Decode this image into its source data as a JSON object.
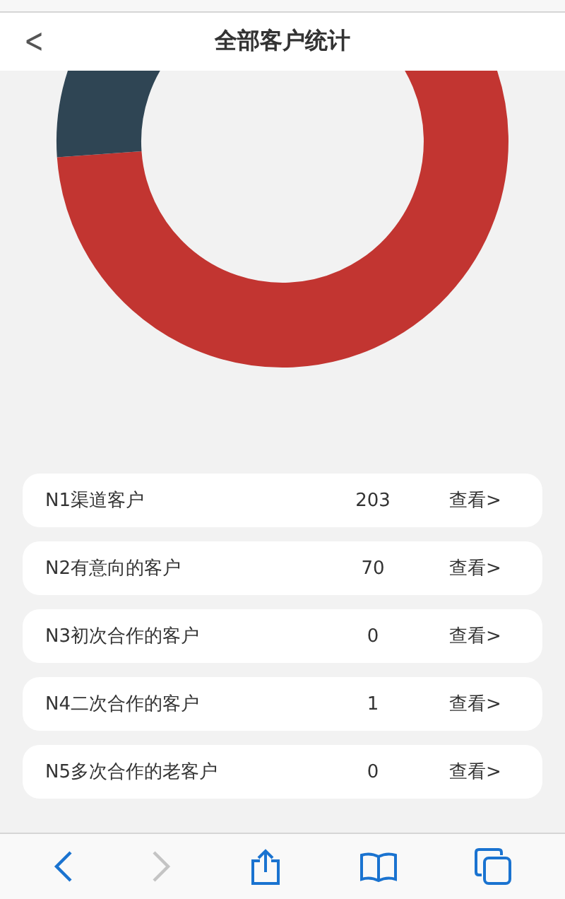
{
  "header": {
    "title": "全部客户统计",
    "back": "<"
  },
  "rows": [
    {
      "label": "N1渠道客户",
      "count": "203",
      "action": "查看>"
    },
    {
      "label": "N2有意向的客户",
      "count": "70",
      "action": "查看>"
    },
    {
      "label": "N3初次合作的客户",
      "count": "0",
      "action": "查看>"
    },
    {
      "label": "N4二次合作的客户",
      "count": "1",
      "action": "查看>"
    },
    {
      "label": "N5多次合作的老客户",
      "count": "0",
      "action": "查看>"
    }
  ],
  "toolbar": [
    {
      "kind": "back",
      "disabled": false
    },
    {
      "kind": "forward",
      "disabled": true
    },
    {
      "kind": "share",
      "disabled": false
    },
    {
      "kind": "bookmarks",
      "disabled": false
    },
    {
      "kind": "tabs",
      "disabled": false
    }
  ]
}
